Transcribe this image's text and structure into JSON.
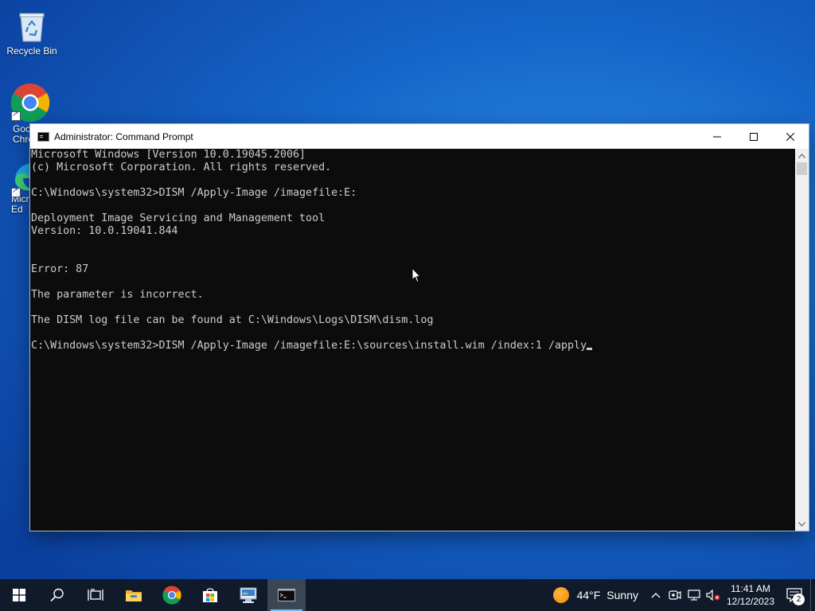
{
  "desktop": {
    "icons": [
      {
        "label": "Recycle Bin",
        "icon": "recycle-bin-icon"
      },
      {
        "label": "Goo\nChro",
        "icon": "chrome-icon"
      },
      {
        "label": "Micro\nEd",
        "icon": "edge-icon"
      }
    ]
  },
  "window": {
    "title": "Administrator: Command Prompt",
    "controls": [
      "minimize",
      "maximize",
      "close"
    ],
    "console_lines": [
      "Microsoft Windows [Version 10.0.19045.2006]",
      "(c) Microsoft Corporation. All rights reserved.",
      "",
      "C:\\Windows\\system32>DISM /Apply-Image /imagefile:E:",
      "",
      "Deployment Image Servicing and Management tool",
      "Version: 10.0.19041.844",
      "",
      "",
      "Error: 87",
      "",
      "The parameter is incorrect.",
      "",
      "The DISM log file can be found at C:\\Windows\\Logs\\DISM\\dism.log",
      "",
      "C:\\Windows\\system32>DISM /Apply-Image /imagefile:E:\\sources\\install.wim /index:1 /apply"
    ]
  },
  "taskbar": {
    "apps": [
      {
        "name": "start",
        "icon": "windows-logo-icon"
      },
      {
        "name": "search",
        "icon": "search-icon"
      },
      {
        "name": "task-view",
        "icon": "task-view-icon"
      },
      {
        "name": "file-explorer",
        "icon": "folder-icon"
      },
      {
        "name": "chrome",
        "icon": "chrome-icon"
      },
      {
        "name": "microsoft-store",
        "icon": "store-icon"
      },
      {
        "name": "control-panel",
        "icon": "control-panel-icon"
      },
      {
        "name": "command-prompt",
        "icon": "cmd-icon"
      }
    ],
    "weather": {
      "temp": "44°F",
      "condition": "Sunny"
    },
    "clock": {
      "time": "11:41 AM",
      "date": "12/12/2023"
    },
    "notifications": {
      "count": "2"
    }
  },
  "colors": {
    "desktop_blue": "#1565c8",
    "taskbar": "#101a2a",
    "console_bg": "#0c0c0c",
    "console_fg": "#cccccc",
    "accent": "#76b9ed"
  }
}
